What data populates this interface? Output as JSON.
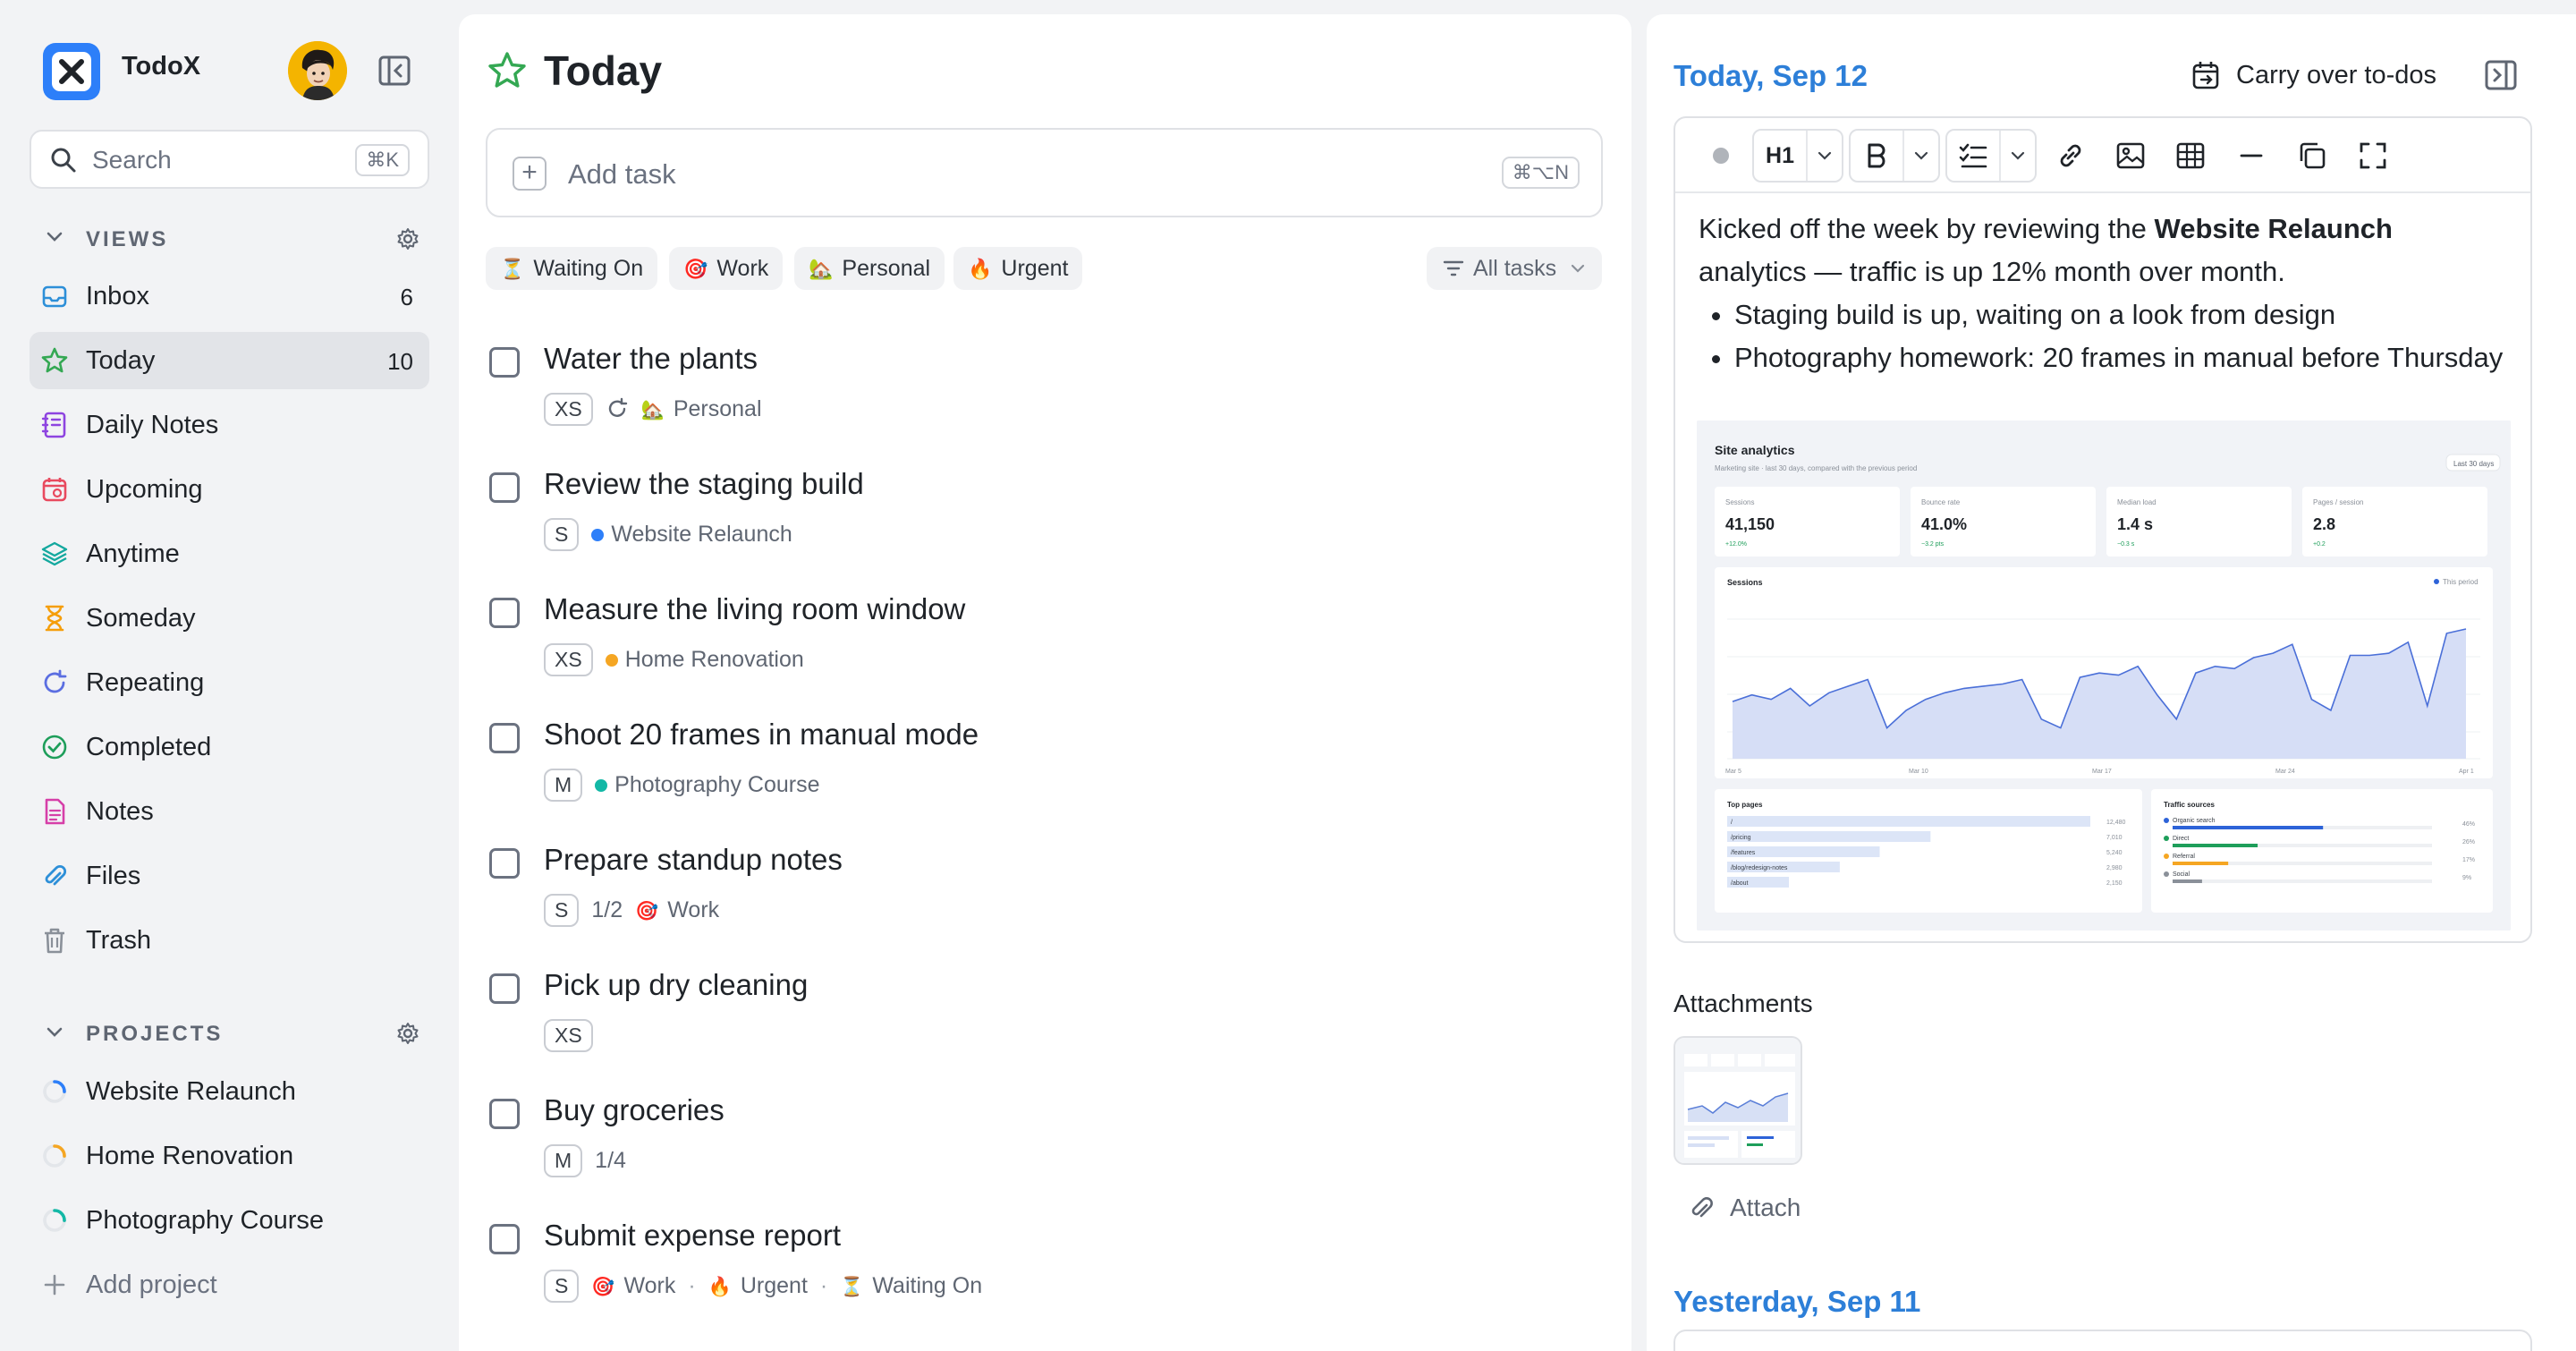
{
  "app": {
    "name": "TodoX"
  },
  "search": {
    "placeholder": "Search",
    "shortcut": "⌘K"
  },
  "views": {
    "header": "VIEWS",
    "items": [
      {
        "label": "Inbox",
        "count": "6",
        "icon": "inbox-icon",
        "color": "#2d8fd8"
      },
      {
        "label": "Today",
        "count": "10",
        "icon": "star-icon",
        "color": "#34a853",
        "active": true
      },
      {
        "label": "Daily Notes",
        "count": "",
        "icon": "notebook-icon",
        "color": "#8e44e0"
      },
      {
        "label": "Upcoming",
        "count": "",
        "icon": "calendar-icon",
        "color": "#e84a5f"
      },
      {
        "label": "Anytime",
        "count": "",
        "icon": "layers-icon",
        "color": "#13a89e"
      },
      {
        "label": "Someday",
        "count": "",
        "icon": "hourglass-icon",
        "color": "#f59e0b"
      },
      {
        "label": "Repeating",
        "count": "",
        "icon": "repeat-icon",
        "color": "#5b6ee1"
      },
      {
        "label": "Completed",
        "count": "",
        "icon": "check-circle-icon",
        "color": "#1e9e5a"
      },
      {
        "label": "Notes",
        "count": "",
        "icon": "note-icon",
        "color": "#d63fa8"
      },
      {
        "label": "Files",
        "count": "",
        "icon": "paperclip-icon",
        "color": "#2d8fd8"
      },
      {
        "label": "Trash",
        "count": "",
        "icon": "trash-icon",
        "color": "#8a9099"
      }
    ]
  },
  "projects": {
    "header": "PROJECTS",
    "items": [
      {
        "label": "Website Relaunch",
        "color": "#2d7ff9",
        "progress": 0.25
      },
      {
        "label": "Home Renovation",
        "color": "#f5a623",
        "progress": 0.25
      },
      {
        "label": "Photography Course",
        "color": "#13b8a6",
        "progress": 0.25
      }
    ],
    "add_label": "Add project"
  },
  "main": {
    "title": "Today",
    "add_task": {
      "placeholder": "Add task",
      "shortcut": "⌘⌥N"
    },
    "filters": [
      {
        "emoji": "⏳",
        "label": "Waiting On"
      },
      {
        "emoji": "🎯",
        "label": "Work"
      },
      {
        "emoji": "🏡",
        "label": "Personal"
      },
      {
        "emoji": "🔥",
        "label": "Urgent"
      }
    ],
    "view_filter": "All tasks",
    "tasks": [
      {
        "title": "Water the plants",
        "size": "XS",
        "repeat": true,
        "progress": "",
        "tags": [
          {
            "emoji": "🏡",
            "label": "Personal"
          }
        ]
      },
      {
        "title": "Review the staging build",
        "size": "S",
        "project": {
          "label": "Website Relaunch",
          "color": "#2d7ff9"
        }
      },
      {
        "title": "Measure the living room window",
        "size": "XS",
        "project": {
          "label": "Home Renovation",
          "color": "#f5a623"
        }
      },
      {
        "title": "Shoot 20 frames in manual mode",
        "size": "M",
        "project": {
          "label": "Photography Course",
          "color": "#13b8a6"
        }
      },
      {
        "title": "Prepare standup notes",
        "size": "S",
        "progress": "1/2",
        "tags": [
          {
            "emoji": "🎯",
            "label": "Work"
          }
        ]
      },
      {
        "title": "Pick up dry cleaning",
        "size": "XS"
      },
      {
        "title": "Buy groceries",
        "size": "M",
        "progress": "1/4"
      },
      {
        "title": "Submit expense report",
        "size": "S",
        "tags": [
          {
            "emoji": "🎯",
            "label": "Work"
          },
          {
            "emoji": "🔥",
            "label": "Urgent"
          },
          {
            "emoji": "⏳",
            "label": "Waiting On"
          }
        ]
      }
    ]
  },
  "panel": {
    "date": "Today, Sep 12",
    "carry_over": "Carry over to-dos",
    "toolbar": {
      "heading": "H1"
    },
    "note": {
      "intro_before": "Kicked off the week by reviewing the ",
      "intro_bold": "Website Relaunch",
      "intro_after": " analytics — traffic is up 12% month over month.",
      "bullets": [
        "Staging build is up, waiting on a look from design",
        "Photography homework: 20 frames in manual before Thursday"
      ]
    },
    "screenshot": {
      "title": "Site analytics",
      "subtitle": "Marketing site · last 30 days, compared with the previous period",
      "range": "Last 30 days",
      "kpis": [
        {
          "label": "Sessions",
          "value": "41,150",
          "delta": "+12.0%"
        },
        {
          "label": "Bounce rate",
          "value": "41.0%",
          "delta": "−3.2 pts"
        },
        {
          "label": "Median load",
          "value": "1.4 s",
          "delta": "−0.3 s"
        },
        {
          "label": "Pages / session",
          "value": "2.8",
          "delta": "+0.2"
        }
      ],
      "chart_title": "Sessions",
      "chart_legend": "This period",
      "chart_x": [
        "Mar 5",
        "Mar 10",
        "Mar 17",
        "Mar 24",
        "Apr 1"
      ],
      "chart_series": [
        46,
        49,
        47,
        52,
        44,
        50,
        53,
        56,
        34,
        42,
        47,
        50,
        52,
        53,
        54,
        56,
        38,
        34,
        57,
        59,
        58,
        62,
        49,
        38,
        59,
        62,
        61,
        66,
        68,
        72,
        47,
        42,
        67,
        67,
        68,
        73,
        44,
        77,
        79
      ],
      "top_pages_title": "Top pages",
      "top_pages": [
        {
          "path": "/",
          "value": "12,480",
          "share": 1.0
        },
        {
          "path": "/pricing",
          "value": "7,010",
          "share": 0.56
        },
        {
          "path": "/features",
          "value": "5,240",
          "share": 0.42
        },
        {
          "path": "/blog/redesign-notes",
          "value": "2,980",
          "share": 0.31
        },
        {
          "path": "/about",
          "value": "2,150",
          "share": 0.17
        }
      ],
      "sources_title": "Traffic sources",
      "sources": [
        {
          "label": "Organic search",
          "pct": "46%",
          "share": 0.46,
          "color": "#2d63d8"
        },
        {
          "label": "Direct",
          "pct": "26%",
          "share": 0.26,
          "color": "#1e9e5a"
        },
        {
          "label": "Referral",
          "pct": "17%",
          "share": 0.17,
          "color": "#f5a623"
        },
        {
          "label": "Social",
          "pct": "9%",
          "share": 0.09,
          "color": "#8a9099"
        }
      ]
    },
    "attachments_header": "Attachments",
    "attach_label": "Attach",
    "yesterday": "Yesterday, Sep 11"
  }
}
